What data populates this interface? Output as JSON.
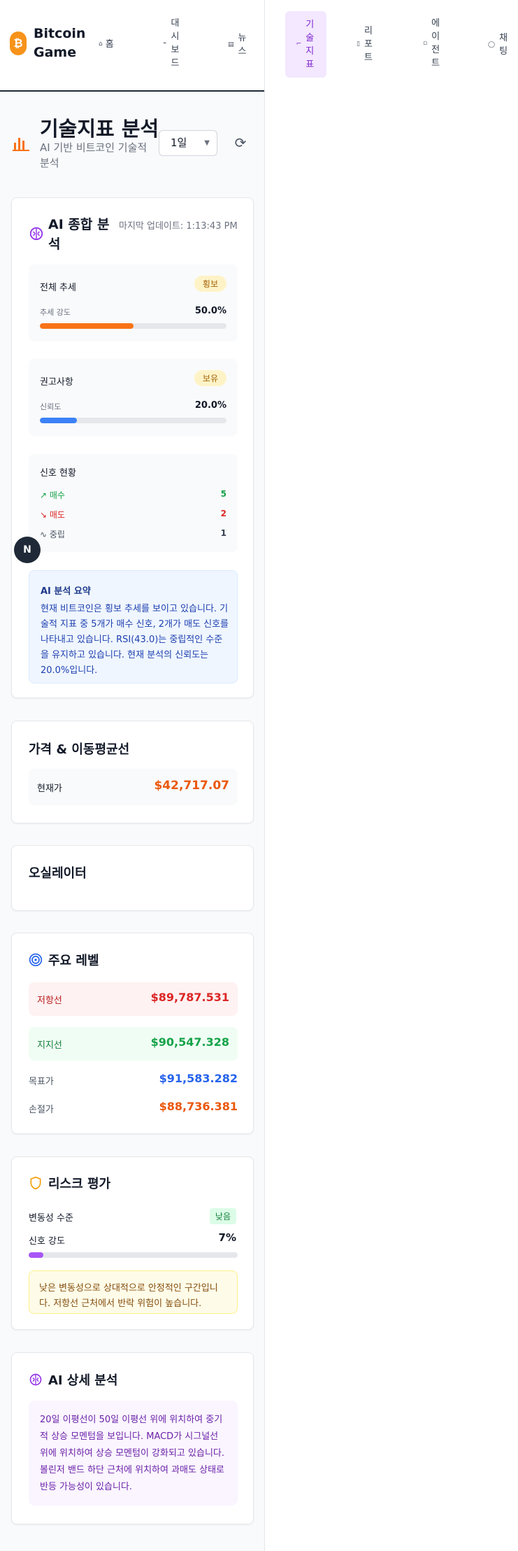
{
  "brand": {
    "icon": "₿",
    "name": "Bitcoin Game"
  },
  "nav": [
    {
      "key": "home",
      "icon": "home-icon",
      "label": "홈"
    },
    {
      "key": "dashboard",
      "icon": "dashboard-icon",
      "label": "대시보드"
    },
    {
      "key": "news",
      "icon": "news-icon",
      "label": "뉴스"
    },
    {
      "key": "technical",
      "icon": "trend-icon",
      "label": "기술지표",
      "active": true
    },
    {
      "key": "report",
      "icon": "report-icon",
      "label": "리포트"
    },
    {
      "key": "agent",
      "icon": "agent-icon",
      "label": "에이전트"
    },
    {
      "key": "chat",
      "icon": "chat-icon",
      "label": "채팅"
    }
  ],
  "page": {
    "title": "기술지표 분석",
    "subtitle": "AI 기반 비트코인 기술적 분석",
    "period": "1일"
  },
  "ai_summary": {
    "title": "AI 종합 분석",
    "updated": "마지막 업데이트: 1:13:43 PM",
    "trend": {
      "label": "전체 추세",
      "badge": "횡보",
      "strength_label": "추세 강도",
      "strength_pct": "50.0%",
      "strength_value": 0.5
    },
    "recommendation": {
      "label": "권고사항",
      "badge": "보유",
      "confidence_label": "신뢰도",
      "confidence_pct": "20.0%",
      "confidence_value": 0.2
    },
    "signals": {
      "title": "신호 현황",
      "buy_label": "매수",
      "buy_count": "5",
      "sell_label": "매도",
      "sell_count": "2",
      "neutral_label": "중립",
      "neutral_count": "1"
    },
    "summary_title": "AI 분석 요약",
    "summary_text": "현재 비트코인은 횡보 추세를 보이고 있습니다. 기술적 지표 중 5개가 매수 신호, 2개가 매도 신호를 나타내고 있습니다. RSI(43.0)는 중립적인 수준을 유지하고 있습니다. 현재 분석의 신뢰도는 20.0%입니다."
  },
  "price": {
    "title": "가격 & 이동평균선",
    "current_label": "현재가",
    "current_value": "$42,717.07"
  },
  "oscillator": {
    "title": "오실레이터"
  },
  "levels": {
    "title": "주요 레벨",
    "resistance_label": "저항선",
    "resistance_value": "$89,787.531",
    "support_label": "지지선",
    "support_value": "$90,547.328",
    "target_label": "목표가",
    "target_value": "$91,583.282",
    "stop_label": "손절가",
    "stop_value": "$88,736.381"
  },
  "risk": {
    "title": "리스크 평가",
    "volatility_label": "변동성 수준",
    "volatility_badge": "낮음",
    "signal_label": "신호 강도",
    "signal_value": "7%",
    "signal_fraction": 0.07,
    "note": "낮은 변동성으로 상대적으로 안정적인 구간입니다. 저항선 근처에서 반락 위험이 높습니다."
  },
  "detail": {
    "title": "AI 상세 분석",
    "text": "20일 이평선이 50일 이평선 위에 위치하여 중기적 상승 모멘텀을 보입니다. MACD가 시그널선 위에 위치하여 상승 모멘텀이 강화되고 있습니다. 볼린저 밴드 하단 근처에 위치하여 과매도 상태로 반등 가능성이 있습니다."
  },
  "dev_badge": "N",
  "colors": {
    "accent": "#7e22ce",
    "orange": "#f97316",
    "blue": "#3b82f6",
    "buy": "#16a34a",
    "sell": "#dc2626",
    "brand": "#f7931a"
  }
}
